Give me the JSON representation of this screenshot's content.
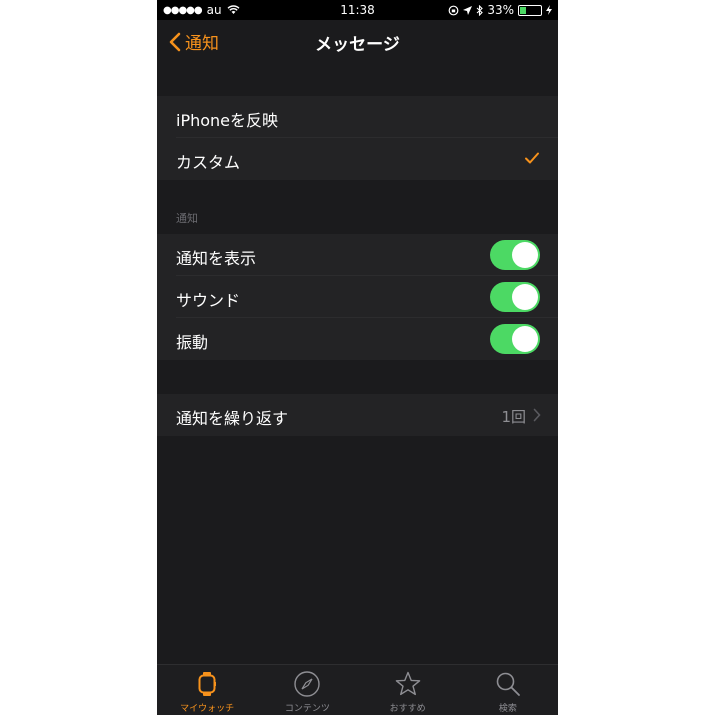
{
  "status_bar": {
    "carrier": "au",
    "time": "11:38",
    "battery_percent": "33%"
  },
  "nav": {
    "back_label": "通知",
    "title": "メッセージ"
  },
  "mode_group": {
    "items": [
      {
        "label": "iPhoneを反映",
        "checked": false
      },
      {
        "label": "カスタム",
        "checked": true
      }
    ]
  },
  "notifications": {
    "header": "通知",
    "items": [
      {
        "label": "通知を表示",
        "on": true
      },
      {
        "label": "サウンド",
        "on": true
      },
      {
        "label": "振動",
        "on": true
      }
    ]
  },
  "repeat": {
    "label": "通知を繰り返す",
    "value": "1回"
  },
  "tabs": [
    {
      "label": "マイウォッチ",
      "icon": "watch-icon",
      "active": true
    },
    {
      "label": "コンテンツ",
      "icon": "compass-icon",
      "active": false
    },
    {
      "label": "おすすめ",
      "icon": "star-icon",
      "active": false
    },
    {
      "label": "検索",
      "icon": "search-icon",
      "active": false
    }
  ],
  "colors": {
    "accent": "#f7921c",
    "toggle_on": "#4cd964",
    "background": "#1b1b1d"
  }
}
